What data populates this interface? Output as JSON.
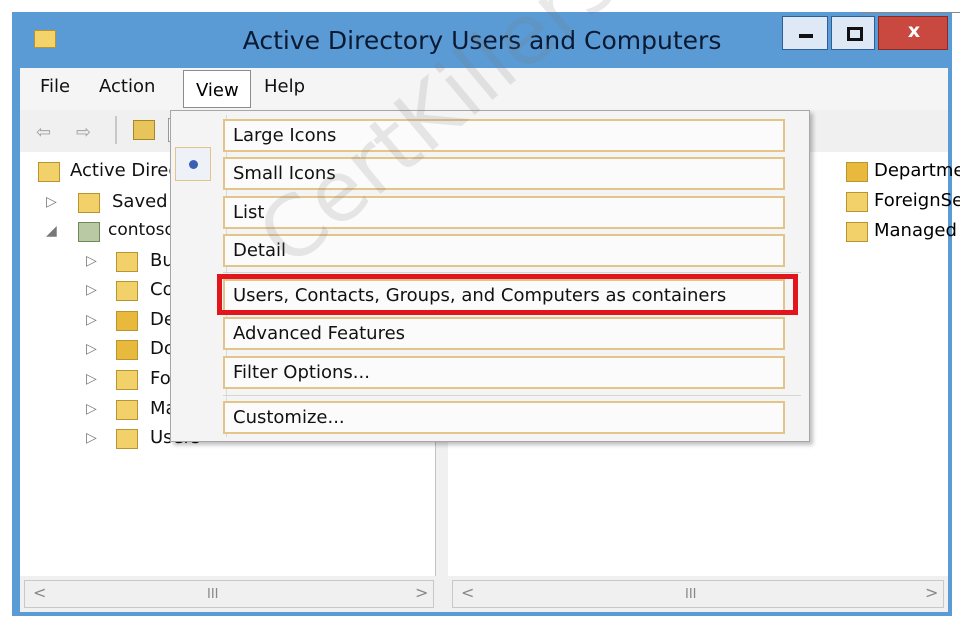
{
  "window": {
    "title": "Active Directory Users and Computers",
    "close_glyph": "x"
  },
  "menubar": {
    "file": "File",
    "action": "Action",
    "view": "View",
    "help": "Help"
  },
  "toolbar": {
    "back_glyph": "⇦",
    "forward_glyph": "⇨"
  },
  "tree": {
    "root": "Active Direc",
    "saved_queries": "Saved Q",
    "domain": "contoso",
    "children": [
      "Built",
      "Com",
      "Dep",
      "Dom",
      "Fore",
      "Man",
      "Users"
    ],
    "expander_collapsed": "▷",
    "expander_expanded": "◢"
  },
  "right_pane": {
    "items": [
      "Departme",
      "ForeignSe",
      "Managed"
    ]
  },
  "view_menu": {
    "items": [
      "Large Icons",
      "Small Icons",
      "List",
      "Detail",
      "Users, Contacts, Groups, and Computers as containers",
      "Advanced Features",
      "Filter Options...",
      "Customize..."
    ],
    "selected_item": "Small Icons"
  },
  "scrollbars": {
    "left_arrow": "<",
    "right_arrow": ">",
    "thumb": "III"
  },
  "watermark": "CertKillers.n",
  "colors": {
    "title_bar": "#5b9bd5",
    "highlight": "#e2141c",
    "menu_item_border": "#e3c489"
  }
}
